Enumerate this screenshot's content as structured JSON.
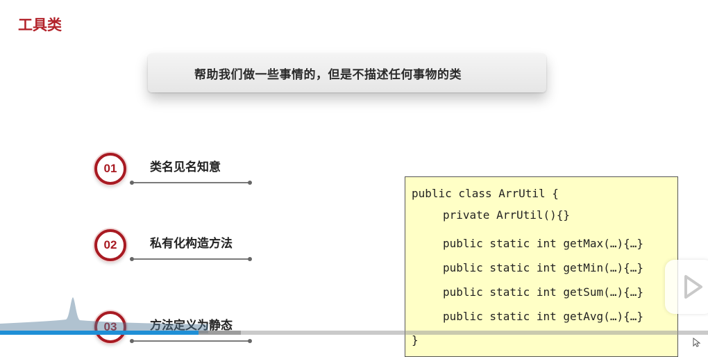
{
  "slide": {
    "title": "工具类",
    "banner": "帮助我们做一些事情的，但是不描述任何事物的类",
    "items": [
      {
        "number": "01",
        "label": "类名见名知意"
      },
      {
        "number": "02",
        "label": "私有化构造方法"
      },
      {
        "number": "03",
        "label": "方法定义为静态"
      }
    ],
    "code": {
      "lines": [
        "public class ArrUtil {",
        "private ArrUtil(){}",
        "public static int getMax(…){…}",
        "public static int getMin(…){…}",
        "public static int getSum(…){…}",
        "public static int getAvg(…){…}",
        "}"
      ]
    }
  },
  "player": {
    "progress": 0.28,
    "buffered": 0.34,
    "progress_color": "#1f8fd6",
    "play_icon": "play-icon",
    "cursor_icon": "cursor-icon"
  },
  "colors": {
    "accent": "#b2222a",
    "code_background": "#ffffc6"
  }
}
